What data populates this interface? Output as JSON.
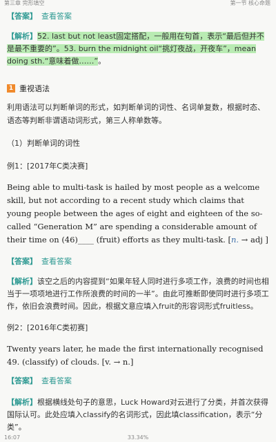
{
  "status_bar": {
    "left": "第三章  完形填空",
    "right": "第一节  核心命题"
  },
  "block1": {
    "answer_tag": "【答案】",
    "answer_link": "查看答案",
    "exp_tag": "【解析】",
    "exp_text_hl_1": "52. last but not least固定搭配，一般用在句首，表示“最后但并不是最不重要的”。53. burn the midnight oil“挑灯夜战，开夜车”，mean doing sth.“意味着做……”",
    "exp_text_end": "。"
  },
  "section1": {
    "num": "1",
    "title": "重视语法"
  },
  "intro": "利用语法可以判断单词的形式，如判断单词的词性、名词单复数，根据时态、语态等判断非谓语动词形式，第三人称单数等。",
  "subhead": "（1）判断单词的词性",
  "example1": {
    "label": "例1：[2017年C类决赛]",
    "text": "Being able to multi-task is hailed by most people as a welcome skill, but not according to a recent study which claims that young people between the ages of eight and eighteen of the so-called “Generation M” are spending a considerable amount of their time on (46)____ (fruit) efforts as they multi-task. [",
    "hint_n": "n.",
    "hint_rest": " → adj ]"
  },
  "block2": {
    "answer_tag": "【答案】",
    "answer_link": "查看答案",
    "exp_tag": "【解析】",
    "exp_text": "该空之后的内容提到“如果年轻人同时进行多项工作，浪费的时间也相当于一项项地进行工作所浪费的时间的一半”。由此可推断即使同时进行多项工作，依旧会浪费时间。因此，根据文意应填入fruit的形容词形式fruitless。"
  },
  "example2": {
    "label": "例2：[2016年C类初赛]",
    "text": "Twenty years later, he made the first internationally recognised 49.        (classify) of clouds. [v. → n.]"
  },
  "block3": {
    "answer_tag": "【答案】",
    "answer_link": "查看答案",
    "exp_tag": "【解析】",
    "exp_text": "根据横线处句子的意思，Luck Howard对云进行了分类，并首次获得国际认可。此处应填入classify的名词形式，因此填classification，表示“分类”。"
  },
  "bottom_bar": {
    "time": "16:07",
    "progress": "33.34%"
  }
}
